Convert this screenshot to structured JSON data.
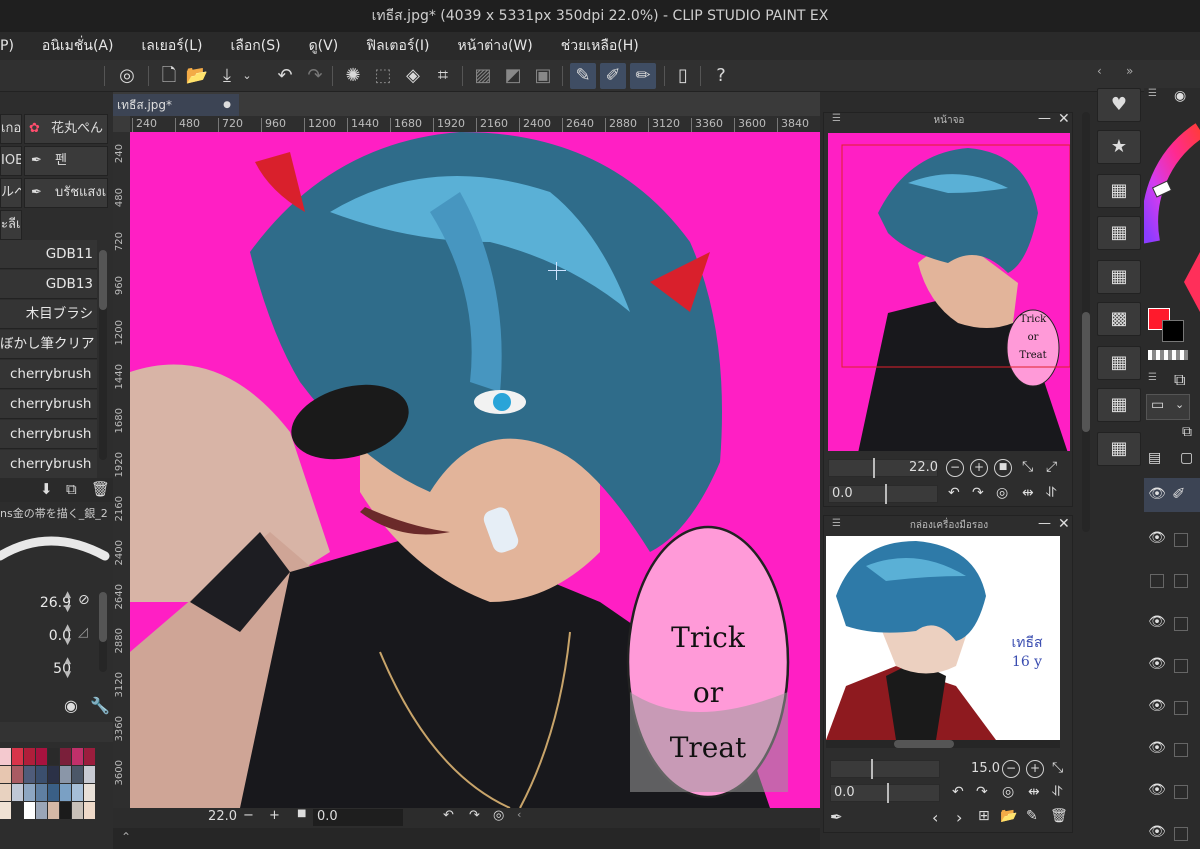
{
  "window": {
    "title": "เทธีส.jpg* (4039 x 5331px 350dpi 22.0%)  - CLIP STUDIO PAINT EX"
  },
  "menu": [
    "P)",
    "อนิเมชั่น(A)",
    "เลเยอร์(L)",
    "เลือก(S)",
    "ดู(V)",
    "ฟิลเตอร์(I)",
    "หน้าต่าง(W)",
    "ช่วยเหลือ(H)"
  ],
  "document": {
    "tab_label": "เทธีส.jpg*"
  },
  "ruler": {
    "top_ticks": [
      "240",
      "480",
      "720",
      "960",
      "1200",
      "1440",
      "1680",
      "1920",
      "2160",
      "2400",
      "2640",
      "2880",
      "3120",
      "3360",
      "3600",
      "3840"
    ],
    "left_ticks": [
      "240",
      "480",
      "720",
      "960",
      "1200",
      "1440",
      "1680",
      "1920",
      "2160",
      "2400",
      "2640",
      "2880",
      "3120",
      "3360",
      "3600"
    ]
  },
  "left_panel": {
    "tiles": [
      {
        "label": "เกอ"
      },
      {
        "label": "花丸ぺん"
      },
      {
        "label": "IOB"
      },
      {
        "label": "펜"
      },
      {
        "label": "ルペ"
      },
      {
        "label": "บรัชแสงเ"
      },
      {
        "label": "ะลีเ"
      }
    ],
    "brushes": [
      "GDB11",
      "GDB13",
      "木目ブラシ",
      "ぼかし筆クリア",
      "cherrybrush",
      "cherrybrush",
      "cherrybrush",
      "cherrybrush"
    ],
    "selected_brush_name": "ns金の帯を描く_銀_2",
    "brush_size": "26.9",
    "antialias": "0.0",
    "density": "50"
  },
  "canvas_speech_bubble": [
    "Trick",
    "or",
    "Treat"
  ],
  "status": {
    "zoom": "22.0",
    "angle": "0.0"
  },
  "navigator": {
    "title": "หน้าจอ",
    "zoom": "22.0",
    "angle": "0.0",
    "bubble": [
      "Trick",
      "or",
      "Treat"
    ]
  },
  "subview": {
    "title": "กล่องเครื่องมือรอง",
    "zoom": "15.0",
    "angle": "0.0",
    "signature": "เทธีส 16 y"
  },
  "colors": {
    "accent": "#3f4d63",
    "canvas_bg": "#ff1fc4",
    "main_color": "#ff1a2c",
    "sub_color": "#000000"
  }
}
